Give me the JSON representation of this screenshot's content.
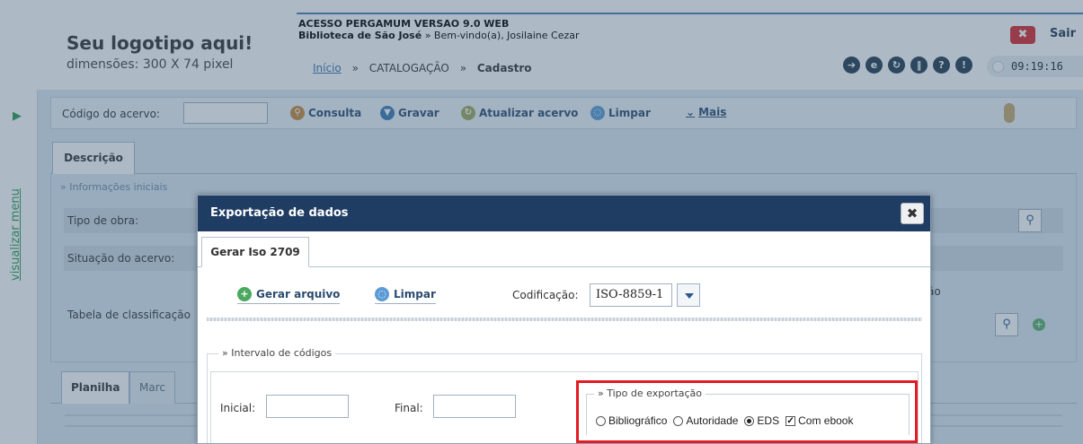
{
  "header": {
    "logo_title": "Seu logotipo aqui!",
    "logo_subtitle": "dimensões: 300 X 74 pixel",
    "system_title": "ACESSO PERGAMUM VERSAO 9.0 WEB",
    "library_name": "Biblioteca de São José",
    "welcome_text": "» Bem-vindo(a), Josilaine Cezar",
    "breadcrumb": {
      "home": "Início",
      "sep": "»",
      "section": "CATALOGAÇÃO",
      "current": "Cadastro"
    },
    "logout_label": "Sair",
    "logout_icon": "close-icon",
    "clock_time": "09:19:16",
    "tool_icons": [
      "arrow-icon",
      "e-icon",
      "refresh-icon",
      "pause-icon",
      "help-icon",
      "warning-icon"
    ]
  },
  "sidebar": {
    "menu_label": "visualizar menu"
  },
  "toolbar": {
    "code_label": "Código do acervo:",
    "code_value": "",
    "consulta": "Consulta",
    "gravar": "Gravar",
    "atualizar": "Atualizar acervo",
    "limpar": "Limpar",
    "mais": "Mais"
  },
  "background_form": {
    "tab_descricao": "Descrição",
    "legend_info": "» Informações iniciais",
    "tipo_obra_label": "Tipo de obra:",
    "situacao_label": "Situação do acervo:",
    "tabela_label": "Tabela de classificação",
    "column_header_fragment": "ão",
    "lower_tabs": [
      "Planilha",
      "Marc"
    ]
  },
  "modal": {
    "title": "Exportação de dados",
    "tab_label": "Gerar Iso 2709",
    "gerar_arquivo": "Gerar arquivo",
    "limpar": "Limpar",
    "codificacao_label": "Codificação:",
    "codificacao_value": "ISO-8859-1",
    "intervalo_legend": "» Intervalo de códigos",
    "inicial_label": "Inicial:",
    "inicial_value": "",
    "final_label": "Final:",
    "final_value": "",
    "tipo_legend": "» Tipo de exportação",
    "options": {
      "bibliografico": "Bibliográfico",
      "autoridade": "Autoridade",
      "eds": "EDS",
      "com_ebook": "Com ebook"
    },
    "selected_option": "EDS",
    "com_ebook_checked": true
  },
  "colors": {
    "accent_dark": "#1f3d63",
    "highlight_red": "#e31b23",
    "menu_green": "#2e9a4e"
  }
}
